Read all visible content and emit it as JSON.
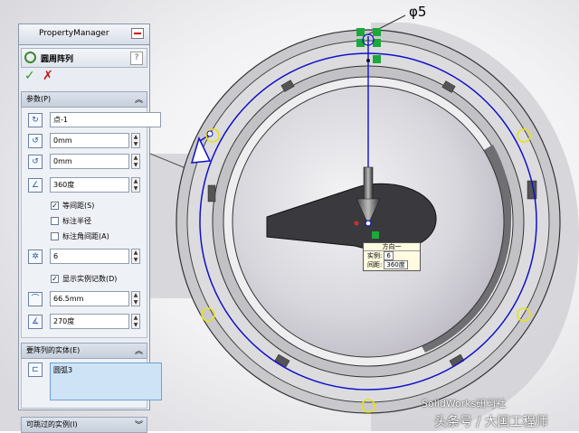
{
  "panel": {
    "header_title": "PropertyManager",
    "feature_title": "圆周阵列",
    "help": "?",
    "ok": "✓",
    "cancel": "✗",
    "params_group": {
      "title": "参数(P)",
      "center_point": "点-1",
      "offset_1": "0mm",
      "offset_2": "0mm",
      "angle": "360度",
      "equal_spacing": {
        "label": "等间距(S)",
        "checked": true
      },
      "dim_radius": {
        "label": "标注半径",
        "checked": false
      },
      "dim_angle_spacing": {
        "label": "标注角间距(A)",
        "checked": false
      },
      "instances": "6",
      "show_count": {
        "label": "显示实例记数(D)",
        "checked": true
      },
      "radius": "66.5mm",
      "arc_angle": "270度"
    },
    "entities_group": {
      "title": "要阵列的实体(E)",
      "items": [
        "圆弧3"
      ]
    },
    "skip_group": {
      "title": "可跳过的实例(I)"
    }
  },
  "viewport": {
    "dimension_label": "φ5",
    "tooltip": {
      "title": "方向一",
      "instances_label": "实例:",
      "instances_value": "6",
      "spacing_label": "间距:",
      "spacing_value": "360度"
    }
  },
  "watermark": {
    "line1": "SolidWorks研习社",
    "line2": "头条号 / 大国工程师"
  },
  "colors": {
    "sketch_blue": "#1010c8",
    "instance_yellow": "#e6e21a",
    "handle_green": "#1ca83a"
  }
}
